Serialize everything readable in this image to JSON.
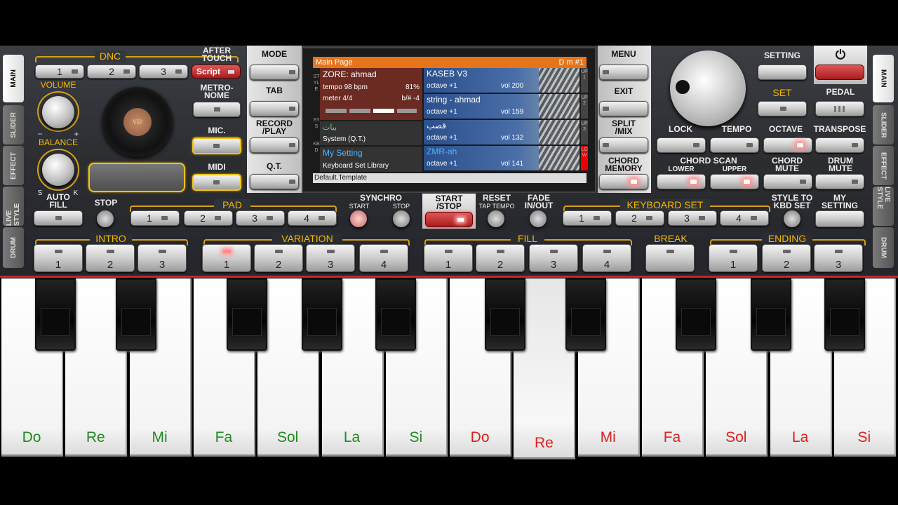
{
  "left_panel": {
    "dnc": "DNC",
    "after_touch": "AFTER\nTOUCH",
    "script": "Script",
    "volume": "VOLUME",
    "balance": "BALANCE",
    "metronome": "METRO-\nNOME",
    "mic": "MIC.",
    "midi": "MIDI",
    "auto_fill": "AUTO\nFILL",
    "turntable": "VIP",
    "pm": "−",
    "pp": "+",
    "ps": "S",
    "pk": "K"
  },
  "dnc_buttons": [
    "1",
    "2",
    "3"
  ],
  "side_left": [
    "MAIN",
    "SLIDER",
    "EFFECT",
    "LIVE STYLE",
    "DRUM"
  ],
  "side_right": [
    "MAIN",
    "SLIDER",
    "EFFECT",
    "LIVE STYLE",
    "DRUM"
  ],
  "center_left": {
    "mode": "MODE",
    "tab": "TAB",
    "record_play": "RECORD\n/PLAY",
    "qt": "Q.T."
  },
  "center_right": {
    "menu": "MENU",
    "exit": "EXIT",
    "split_mix": "SPLIT\n/MIX",
    "chord_memory": "CHORD\nMEMORY"
  },
  "lcd": {
    "title": "Main Page",
    "chord": "D m #1",
    "style_name": "ZORE: ahmad",
    "tempo": "tempo 98 bpm",
    "percent": "81%",
    "meter": "meter 4/4",
    "bsharp": "b/# -4",
    "sys_name": "بيات",
    "sys_sub": "System (Q.T.)",
    "kbd_name": "My Setting",
    "kbd_sub": "Keyboard Set Library",
    "footer": "Default.Template",
    "style_side": "STYLE",
    "sys_side": "SYS",
    "kbd_side": "KBD",
    "upper": [
      {
        "name": "KASEB V3",
        "octave": "octave +1",
        "vol": "vol 200",
        "tag": "UP1"
      },
      {
        "name": "string - ahmad",
        "octave": "octave +1",
        "vol": "vol 159",
        "tag": "UP2"
      },
      {
        "name": "قصب",
        "octave": "octave +1",
        "vol": "vol 132",
        "tag": "UP3"
      },
      {
        "name": "ZMR-ah",
        "octave": "octave +1",
        "vol": "vol 141",
        "tag": "LOW"
      }
    ]
  },
  "right_panel": {
    "setting": "SETTING",
    "set": "SET",
    "pedal": "PEDAL",
    "lock": "LOCK",
    "tempo": "TEMPO",
    "octave": "OCTAVE",
    "transpose": "TRANSPOSE",
    "chord_scan": "CHORD SCAN",
    "lower": "LOWER",
    "upper": "UPPER",
    "chord_mute": "CHORD\nMUTE",
    "drum_mute": "DRUM\nMUTE",
    "power": "⏻"
  },
  "row3": {
    "stop": "STOP",
    "pad": "PAD",
    "synchro": "SYNCHRO",
    "sync_start": "START",
    "sync_stop": "STOP",
    "start_stop": "START\n/STOP",
    "reset": "RESET",
    "tap_tempo": "TAP TEMPO",
    "fade": "FADE\nIN/OUT",
    "keyboard_set": "KEYBOARD SET",
    "style_to_kbd": "STYLE TO\nKBD SET",
    "my_setting": "MY\nSETTING",
    "pad_nums": [
      "1",
      "2",
      "3",
      "4"
    ],
    "kbd_nums": [
      "1",
      "2",
      "3",
      "4"
    ]
  },
  "row4": {
    "intro": "INTRO",
    "variation": "VARIATION",
    "fill": "FILL",
    "break": "BREAK",
    "ending": "ENDING",
    "intro_nums": [
      "1",
      "2",
      "3"
    ],
    "variation_nums": [
      "1",
      "2",
      "3",
      "4"
    ],
    "fill_nums": [
      "1",
      "2",
      "3",
      "4"
    ],
    "ending_nums": [
      "1",
      "2",
      "3"
    ]
  },
  "keys": [
    {
      "n": "Do",
      "c": "#1f8a1f"
    },
    {
      "n": "Re",
      "c": "#1f8a1f"
    },
    {
      "n": "Mi",
      "c": "#1f8a1f"
    },
    {
      "n": "Fa",
      "c": "#1f8a1f"
    },
    {
      "n": "Sol",
      "c": "#1f8a1f"
    },
    {
      "n": "La",
      "c": "#1f8a1f"
    },
    {
      "n": "Si",
      "c": "#1f8a1f"
    },
    {
      "n": "Do",
      "c": "#e02020"
    },
    {
      "n": "Re",
      "c": "#e02020"
    },
    {
      "n": "Mi",
      "c": "#e02020"
    },
    {
      "n": "Fa",
      "c": "#e02020"
    },
    {
      "n": "Sol",
      "c": "#e02020"
    },
    {
      "n": "La",
      "c": "#e02020"
    },
    {
      "n": "Si",
      "c": "#e02020"
    }
  ]
}
